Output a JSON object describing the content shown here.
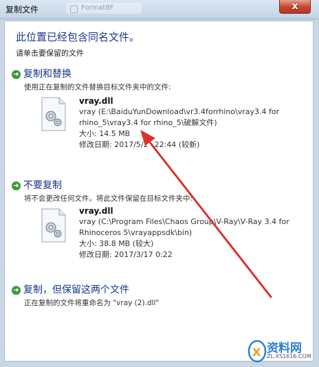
{
  "window": {
    "title": "复制文件",
    "ghost_tab": "Format8F",
    "close_label": "x"
  },
  "header": {
    "heading": "此位置已经包含同名文件。",
    "subheading": "请单击要保留的文件"
  },
  "options": [
    {
      "title": "复制和替换",
      "desc": "使用正在复制的文件替换目标文件夹中的文件:",
      "file": {
        "name": "vray.dll",
        "path": "vray (E:\\BaiduYunDownload\\vr3.4forrhino\\vray3.4 for rhino_5\\vray3.4 for rhino_5\\破解文件)",
        "size": "大小: 14.5 MB",
        "modified": "修改日期: 2017/5/2  22:44 (较新)"
      }
    },
    {
      "title": "不要复制",
      "desc": "将不会更改任何文件。将此文件保留在目标文件夹中:",
      "file": {
        "name": "vray.dll",
        "path": "vray (C:\\Program Files\\Chaos Group\\V-Ray\\V-Ray 3.4 for Rhinoceros 5\\vrayappsdk\\bin)",
        "size": "大小: 38.8 MB (较大)",
        "modified": "修改日期: 2017/3/17 0:22"
      }
    },
    {
      "title": "复制，但保留这两个文件",
      "desc": "正在复制的文件将重命名为 \"vray (2).dll\""
    }
  ],
  "watermark": {
    "text": "资料网",
    "url": "ZL.XS1616.COM"
  },
  "colors": {
    "title_blue": "#1b3a8a",
    "option_blue": "#15358a",
    "arrow_green": "#3a9a3a",
    "annotation_red": "#d9322a",
    "close_red": "#c5432c"
  }
}
